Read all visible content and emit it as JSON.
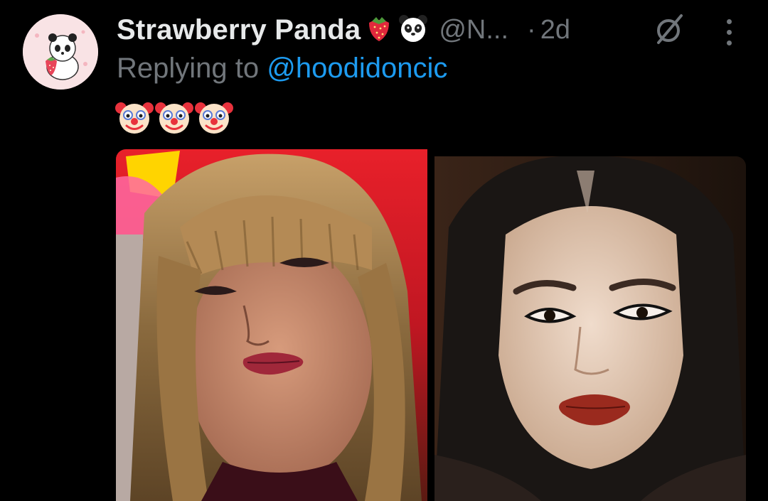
{
  "tweet": {
    "display_name": "Strawberry Panda",
    "name_emojis": [
      "strawberry-emoji",
      "panda-emoji"
    ],
    "handle": "@N...",
    "separator": "·",
    "time": "2d",
    "replying_prefix": "Replying to ",
    "replying_handle": "@hoodidoncic",
    "text_emojis": [
      "clown-face-emoji",
      "clown-face-emoji",
      "clown-face-emoji"
    ],
    "icons": {
      "status": "no-entry-circle-icon",
      "more": "more-vertical-icon"
    },
    "colors": {
      "background": "#000000",
      "name": "#e7e9ea",
      "secondary": "#71767b",
      "link": "#1d9bf0"
    },
    "media": {
      "count": 2,
      "items": [
        "photo-woman-blonde-bangs",
        "photo-woman-dark-hair-red-lips"
      ]
    }
  }
}
